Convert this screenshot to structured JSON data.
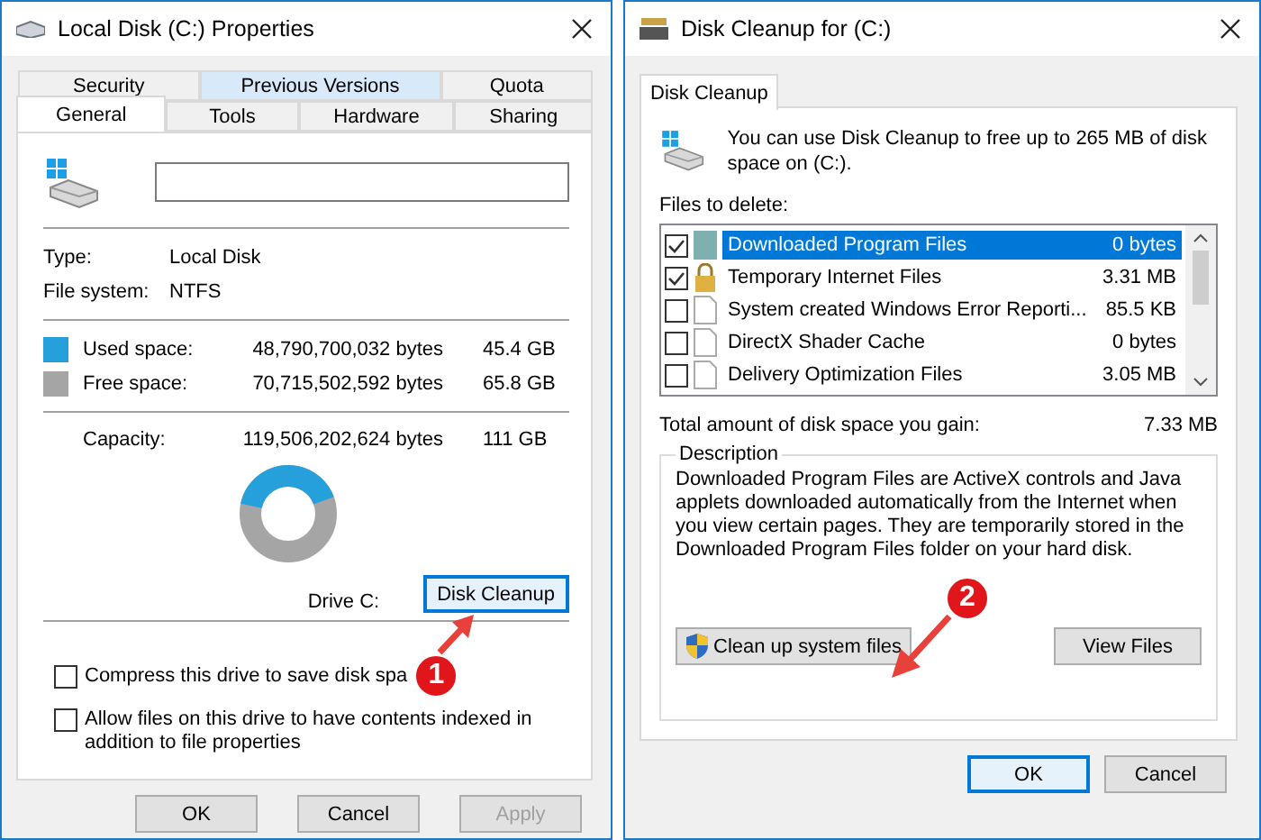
{
  "properties_window": {
    "title": "Local Disk (C:) Properties",
    "tab_rows": [
      [
        {
          "label": "Security",
          "selected": false,
          "highlighted": false
        },
        {
          "label": "Previous Versions",
          "selected": false,
          "highlighted": true
        },
        {
          "label": "Quota",
          "selected": false,
          "highlighted": false
        }
      ],
      [
        {
          "label": "General",
          "selected": true,
          "highlighted": false
        },
        {
          "label": "Tools",
          "selected": false,
          "highlighted": false
        },
        {
          "label": "Hardware",
          "selected": false,
          "highlighted": false
        },
        {
          "label": "Sharing",
          "selected": false,
          "highlighted": false
        }
      ]
    ],
    "info": [
      {
        "label": "Type:",
        "value": "Local Disk"
      },
      {
        "label": "File system:",
        "value": "NTFS"
      }
    ],
    "space": [
      {
        "label": "Used space:",
        "bytes": "48,790,700,032 bytes",
        "size": "45.4 GB",
        "color": "#26a0da"
      },
      {
        "label": "Free space:",
        "bytes": "70,715,502,592 bytes",
        "size": "65.8 GB",
        "color": "#a5a5a5"
      }
    ],
    "capacity": {
      "label": "Capacity:",
      "bytes": "119,506,202,624 bytes",
      "size": "111 GB"
    },
    "drive_label": "Drive C:",
    "cleanup_button": "Disk Cleanup",
    "options": [
      {
        "label": "Compress this drive to save disk spa",
        "checked": false
      },
      {
        "label": "Allow files on this drive to have contents indexed in addition to file properties",
        "checked": false
      }
    ],
    "buttons": [
      {
        "label": "OK",
        "disabled": false
      },
      {
        "label": "Cancel",
        "disabled": false
      },
      {
        "label": "Apply",
        "disabled": true
      }
    ]
  },
  "cleanup_window": {
    "title": "Disk Cleanup for  (C:)",
    "tab": {
      "label": "Disk Cleanup",
      "selected": true
    },
    "intro": "You can use Disk Cleanup to free up to 265 MB of disk space on  (C:).",
    "files_label": "Files to delete:",
    "files": [
      {
        "name": "Downloaded Program Files",
        "size": "0 bytes",
        "checked": true,
        "selected": true,
        "kind": "program"
      },
      {
        "name": "Temporary Internet Files",
        "size": "3.31 MB",
        "checked": true,
        "selected": false,
        "kind": "lock"
      },
      {
        "name": "System created Windows Error Reporti...",
        "size": "85.5 KB",
        "checked": false,
        "selected": false,
        "kind": "file"
      },
      {
        "name": "DirectX Shader Cache",
        "size": "0 bytes",
        "checked": false,
        "selected": false,
        "kind": "file"
      },
      {
        "name": "Delivery Optimization Files",
        "size": "3.05 MB",
        "checked": false,
        "selected": false,
        "kind": "file"
      }
    ],
    "total_label": "Total amount of disk space you gain:",
    "total_value": "7.33 MB",
    "description_title": "Description",
    "description": "Downloaded Program Files are ActiveX controls and Java applets downloaded automatically from the Internet when you view certain pages. They are temporarily stored in the Downloaded Program Files folder on your hard disk.",
    "system_button": "Clean up system files",
    "view_button": "View Files",
    "buttons": [
      {
        "label": "OK",
        "disabled": false
      },
      {
        "label": "Cancel",
        "disabled": false
      }
    ]
  },
  "annotations": [
    {
      "number": "1"
    },
    {
      "number": "2"
    }
  ]
}
